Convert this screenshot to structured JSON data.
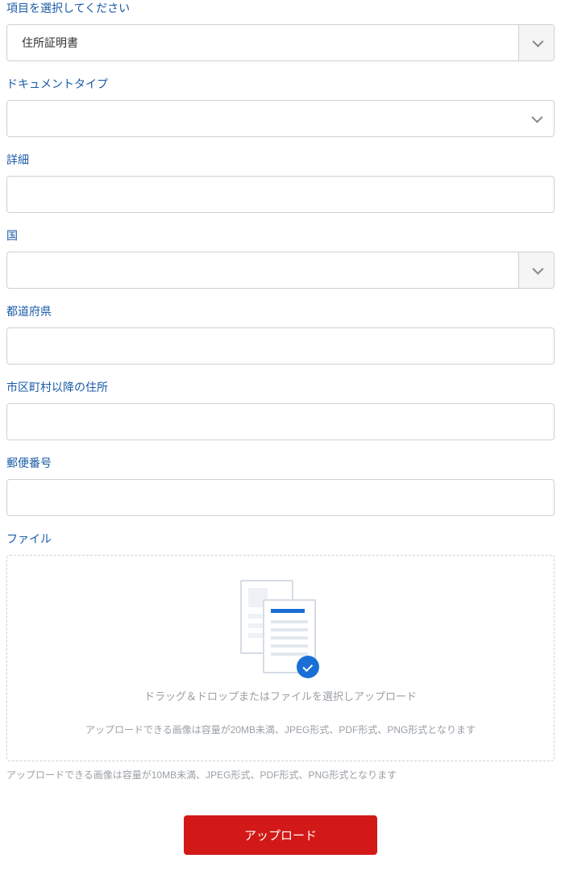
{
  "fields": {
    "item": {
      "label": "項目を選択してください",
      "value": "住所証明書"
    },
    "doctype": {
      "label": "ドキュメントタイプ",
      "value": ""
    },
    "detail": {
      "label": "詳細",
      "value": ""
    },
    "country": {
      "label": "国",
      "value": ""
    },
    "prefecture": {
      "label": "都道府県",
      "value": ""
    },
    "address": {
      "label": "市区町村以降の住所",
      "value": ""
    },
    "postal": {
      "label": "郵便番号",
      "value": ""
    },
    "file": {
      "label": "ファイル"
    }
  },
  "dropzone": {
    "text": "ドラッグ＆ドロップまたはファイルを選択しアップロード",
    "hint": "アップロードできる画像は容量が20MB未満、JPEG形式、PDF形式、PNG形式となります"
  },
  "footer_hint": "アップロードできる画像は容量が10MB未満、JPEG形式、PDF形式、PNG形式となります",
  "submit": {
    "label": "アップロード"
  }
}
